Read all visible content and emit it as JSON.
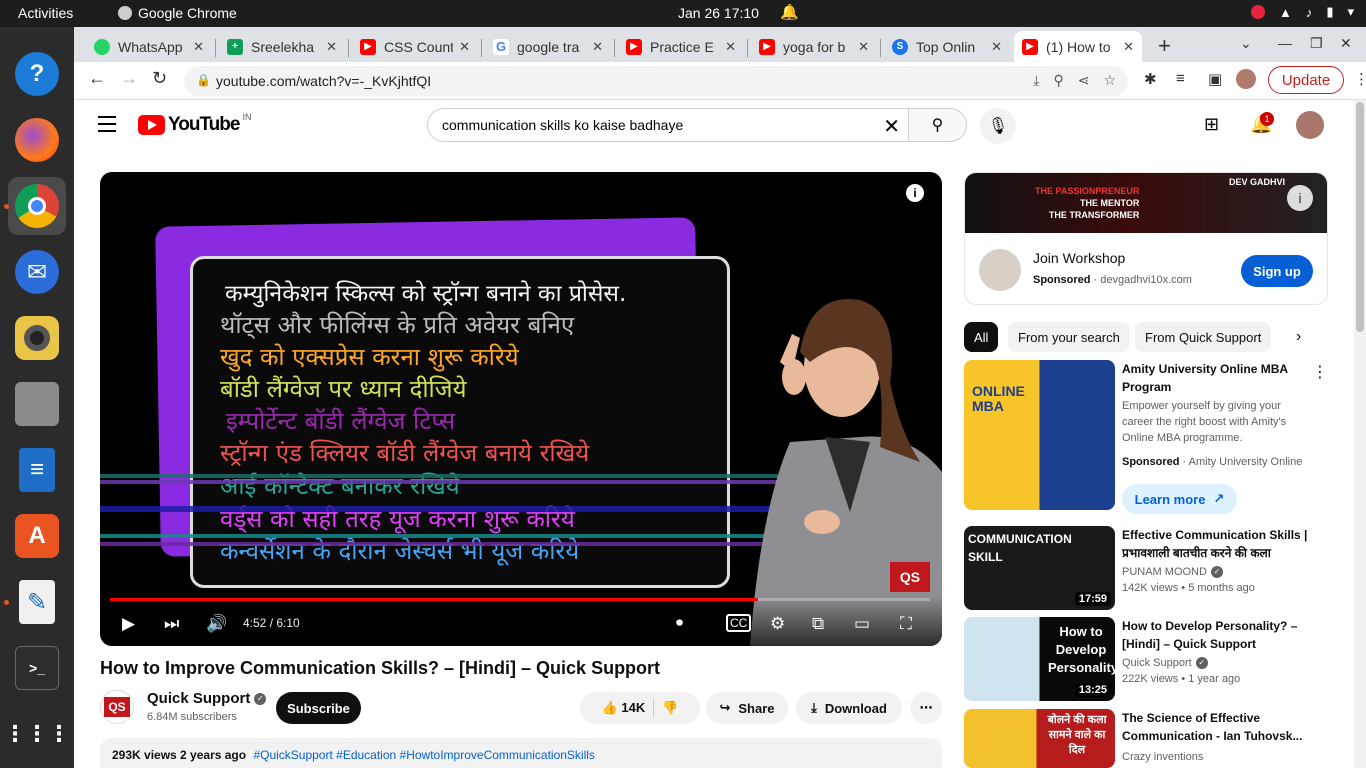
{
  "system": {
    "activities": "Activities",
    "app_name": "Google Chrome",
    "clock": "Jan 26  17:10"
  },
  "browser": {
    "tabs": [
      {
        "title": "WhatsApp",
        "color": "#25d366"
      },
      {
        "title": "Sreelekha",
        "color": "#0f9d58"
      },
      {
        "title": "CSS Count",
        "color": "#ff0000"
      },
      {
        "title": "google tra",
        "color": "#4285f4"
      },
      {
        "title": "Practice E",
        "color": "#ff0000"
      },
      {
        "title": "yoga for b",
        "color": "#ff0000"
      },
      {
        "title": "Top Onlin",
        "color": "#1a73e8"
      },
      {
        "title": "(1) How to",
        "color": "#ff0000"
      }
    ],
    "url": "youtube.com/watch?v=-_KvKjhtfQI",
    "update_label": "Update"
  },
  "youtube": {
    "logo_text": "YouTube",
    "region": "IN",
    "search_value": "communication skills ko kaise badhaye",
    "notification_count": "1"
  },
  "player": {
    "hindi_lines": [
      {
        "text": "कम्युनिकेशन स्किल्स को स्ट्रॉन्ग बनाने का प्रोसेस.",
        "color": "#f5f5f5"
      },
      {
        "text": "थॉट्स और फीलिंग्स के प्रति अवेयर बनिए",
        "color": "#bdbdbd"
      },
      {
        "text": "खुद को एक्सप्रेस करना शुरू करिये",
        "color": "#ffa726"
      },
      {
        "text": "बॉडी लैंग्वेज पर ध्यान दीजिये",
        "color": "#d4e157"
      },
      {
        "text": "इम्पोर्टेन्ट बॉडी लैंग्वेज टिप्स",
        "color": "#9c27b0"
      },
      {
        "text": "स्ट्रॉन्ग एंड क्लियर बॉडी लैंग्वेज बनाये रखिये",
        "color": "#ef5350"
      },
      {
        "text": "आई कॉन्टैक्ट बनाकर रखिये",
        "color": "#26a69a"
      },
      {
        "text": "वर्ड्स को सही तरह यूज करना शुरू करिये",
        "color": "#e040fb"
      },
      {
        "text": "कन्वर्सेशन के दौरान जेस्चर्स भी यूज करिये",
        "color": "#42a5f5"
      }
    ],
    "watermark": "QS",
    "time": "4:52 / 6:10",
    "progress": 0.79
  },
  "video": {
    "title": "How to Improve Communication Skills? – [Hindi] – Quick Support",
    "channel": "Quick Support",
    "channel_logo": "QS",
    "subscribers": "6.84M subscribers",
    "subscribe_label": "Subscribe",
    "likes": "14K",
    "share_label": "Share",
    "download_label": "Download",
    "views_date": "293K views  2 years ago",
    "tags": "#QuickSupport #Education #HowtoImproveCommunicationSkills"
  },
  "ad": {
    "banner_line1": "THE PASSIONPRENEUR",
    "banner_line2": "THE MENTOR",
    "banner_line3": "THE TRANSFORMER",
    "banner_brand": "DEV GADHVI",
    "title": "Join Workshop",
    "sponsored": "Sponsored",
    "domain": "devgadhvi10x.com",
    "cta": "Sign up"
  },
  "chips": [
    "All",
    "From your search",
    "From Quick Support"
  ],
  "recommendations": [
    {
      "title": "Amity University Online MBA Program",
      "desc": "Empower yourself by giving your career the right boost with Amity's Online MBA programme.",
      "sponsored": "Sponsored",
      "advertiser": "Amity University Online",
      "cta": "Learn more",
      "thumb_text": "ONLINE MBA"
    },
    {
      "title": "Effective Communication Skills | प्रभावशाली बातचीत करने की कला",
      "channel": "PUNAM MOOND",
      "meta": "142K views  •  5 months ago",
      "duration": "17:59",
      "thumb_text": "COMMUNICATION SKILL"
    },
    {
      "title": "How to Develop Personality? – [Hindi] – Quick Support",
      "channel": "Quick Support",
      "meta": "222K views  •  1 year ago",
      "duration": "13:25",
      "thumb_text": "How to Develop Personality?"
    },
    {
      "title": "The Science of Effective Communication - Ian Tuhovsk...",
      "channel": "Crazy inventions",
      "meta": "",
      "duration": "",
      "thumb_text": "बोलने की कला सामने वाले का दिल"
    }
  ]
}
